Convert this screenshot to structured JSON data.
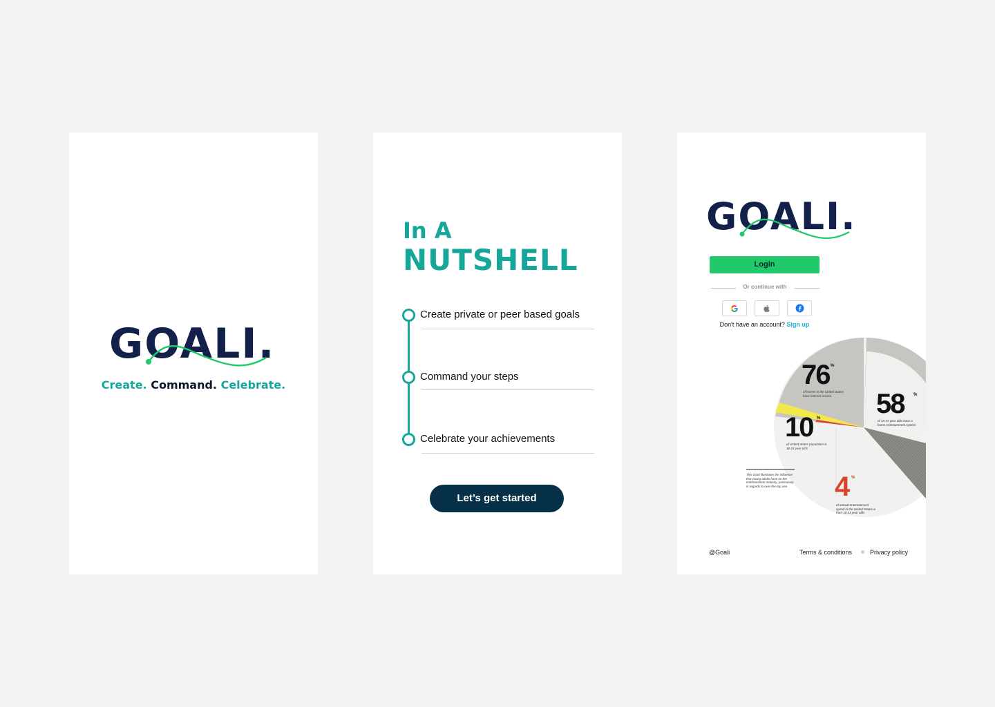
{
  "brand": {
    "logo_text": "GOALI.",
    "navy": "#13204a",
    "teal": "#17a79a",
    "green": "#21c96a"
  },
  "splash": {
    "tagline_create": "Create.",
    "tagline_command": "Command.",
    "tagline_celebrate": "Celebrate."
  },
  "nutshell": {
    "heading_small": "In A",
    "heading_big": "NUTSHELL",
    "steps": [
      {
        "label": "Create private or peer based goals"
      },
      {
        "label": "Command your steps"
      },
      {
        "label": "Celebrate your achievements"
      }
    ],
    "cta_label": "Let’s get started"
  },
  "login": {
    "login_label": "Login",
    "divider_text": "Or continue with",
    "social": [
      {
        "icon": "google-icon"
      },
      {
        "icon": "apple-icon"
      },
      {
        "icon": "facebook-icon"
      }
    ],
    "signup_prompt": "Don't have an account?",
    "signup_link": "Sign up",
    "chart": {
      "stat_76": "76",
      "stat_58": "58",
      "stat_10": "10",
      "stat_4": "4",
      "percent": "%",
      "caption_76": "of homes in the United States have internet access",
      "caption_58": "of 18-24 year olds have a home entertainment system",
      "caption_10": "of United States population is 18-24 year olds",
      "caption_4": "of annual entertainment spend in the United States is from 18-24 year olds",
      "caption_note": "This chart illustrates the influence that young adults have on the entertainment industry, particularly in regards to over-the-top use."
    },
    "footer_handle": "@Goali",
    "footer_terms": "Terms & conditions",
    "footer_privacy": "Privacy policy"
  }
}
